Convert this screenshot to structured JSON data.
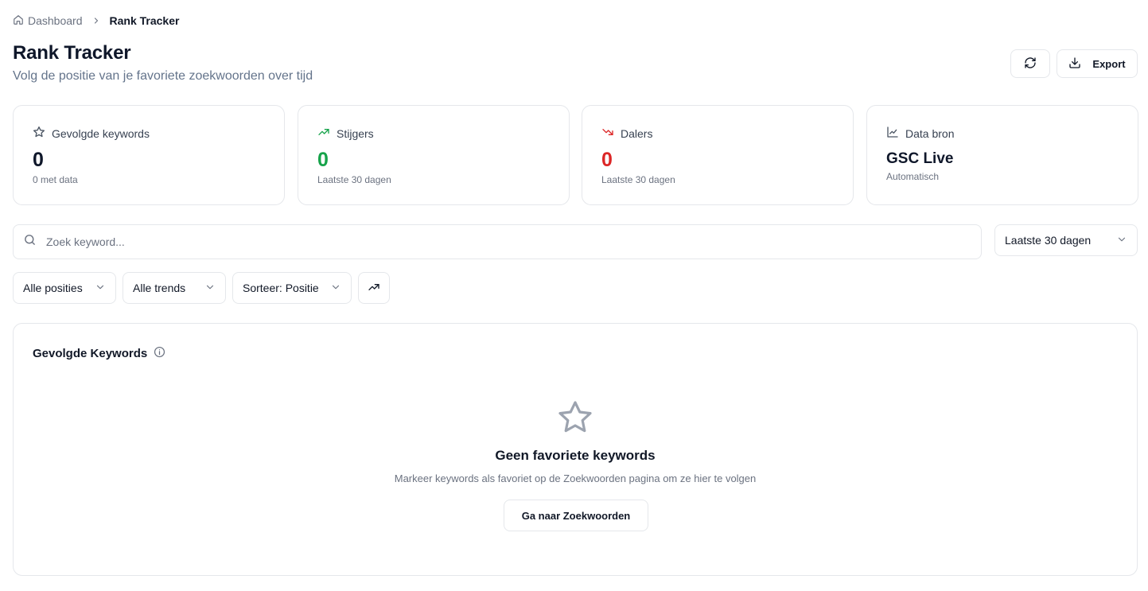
{
  "breadcrumb": {
    "home": "Dashboard",
    "current": "Rank Tracker"
  },
  "header": {
    "title": "Rank Tracker",
    "subtitle": "Volg de positie van je favoriete zoekwoorden over tijd",
    "export_label": "Export"
  },
  "stats": [
    {
      "label": "Gevolgde keywords",
      "value": "0",
      "sub": "0 met data",
      "icon": "star-icon"
    },
    {
      "label": "Stijgers",
      "value": "0",
      "sub": "Laatste 30 dagen",
      "icon": "trending-up-icon",
      "color": "#16a34a"
    },
    {
      "label": "Dalers",
      "value": "0",
      "sub": "Laatste 30 dagen",
      "icon": "trending-down-icon",
      "color": "#dc2626"
    },
    {
      "label": "Data bron",
      "value": "GSC Live",
      "sub": "Automatisch",
      "icon": "line-chart-icon"
    }
  ],
  "search": {
    "placeholder": "Zoek keyword...",
    "value": ""
  },
  "filters": {
    "period": "Laatste 30 dagen",
    "positions": "Alle posities",
    "trends": "Alle trends",
    "sort": "Sorteer: Positie"
  },
  "panel": {
    "title": "Gevolgde Keywords",
    "empty_title": "Geen favoriete keywords",
    "empty_text": "Markeer keywords als favoriet op de Zoekwoorden pagina om ze hier te volgen",
    "button_label": "Ga naar Zoekwoorden"
  }
}
